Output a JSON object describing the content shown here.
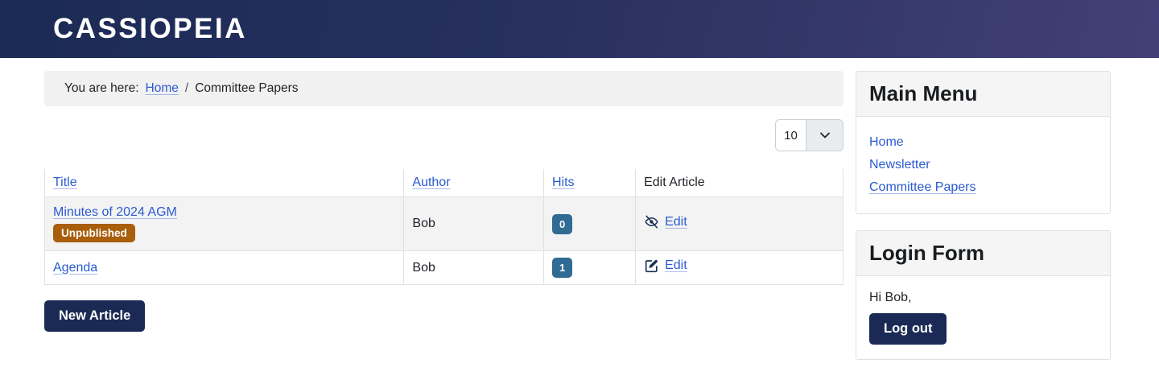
{
  "header": {
    "brand": "CASSIOPEIA"
  },
  "breadcrumb": {
    "prefix": "You are here:",
    "home": "Home",
    "separator": "/",
    "current": "Committee Papers"
  },
  "filter": {
    "selected": "10"
  },
  "table": {
    "headers": {
      "title": "Title",
      "author": "Author",
      "hits": "Hits",
      "edit": "Edit Article"
    },
    "rows": [
      {
        "title": "Minutes of 2024 AGM",
        "status": "Unpublished",
        "author": "Bob",
        "hits": "0",
        "edit_label": "Edit",
        "edit_icon": "eye-slash-icon"
      },
      {
        "title": "Agenda",
        "author": "Bob",
        "hits": "1",
        "edit_label": "Edit",
        "edit_icon": "pen-square-icon"
      }
    ]
  },
  "actions": {
    "new_article": "New Article"
  },
  "sidebar": {
    "main_menu": {
      "title": "Main Menu",
      "items": [
        {
          "label": "Home",
          "active": false
        },
        {
          "label": "Newsletter",
          "active": false
        },
        {
          "label": "Committee Papers",
          "active": true
        }
      ]
    },
    "login_form": {
      "title": "Login Form",
      "greeting": "Hi Bob,",
      "logout": "Log out"
    }
  },
  "colors": {
    "header_gradient_start": "#1b2a55",
    "header_gradient_end": "#434076",
    "link_blue": "#2a5bd0",
    "button_navy": "#1b2a55",
    "badge_unpublished": "#a85e0a",
    "badge_hits": "#2f6b92",
    "breadcrumb_bg": "#f1f1f2",
    "striped_row_bg": "#f3f3f4"
  }
}
